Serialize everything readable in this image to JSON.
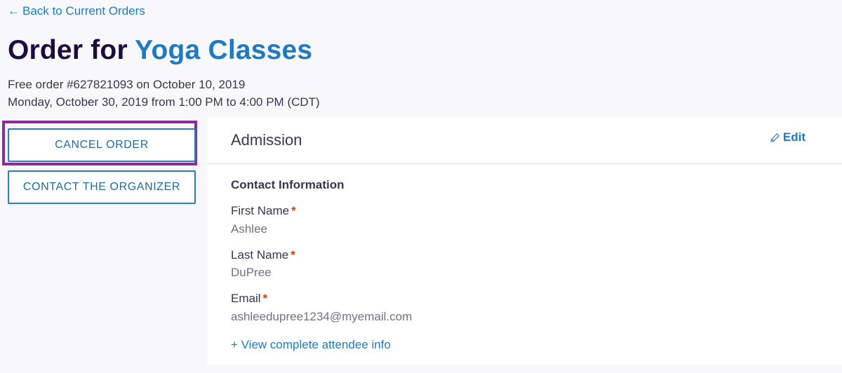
{
  "nav": {
    "back_arrow": "←",
    "back_label": "Back to Current Orders"
  },
  "header": {
    "title_prefix": "Order for",
    "event_name": "Yoga Classes",
    "order_line": "Free order #627821093 on October 10, 2019",
    "date_line": "Monday, October 30, 2019 from 1:00 PM to 4:00 PM (CDT)"
  },
  "actions": {
    "cancel_label": "CANCEL ORDER",
    "contact_label": "CONTACT THE ORGANIZER"
  },
  "ticket": {
    "title": "Admission",
    "edit_label": "Edit",
    "section_heading": "Contact Information",
    "required_marker": "*",
    "fields": [
      {
        "label": "First Name",
        "value": "Ashlee"
      },
      {
        "label": "Last Name",
        "value": "DuPree"
      },
      {
        "label": "Email",
        "value": "ashleedupree1234@myemail.com"
      }
    ],
    "view_more_label": "+ View complete attendee info"
  },
  "colors": {
    "accent": "#1f7bc1",
    "highlight": "#8e2a9e",
    "required": "#d1410c"
  }
}
